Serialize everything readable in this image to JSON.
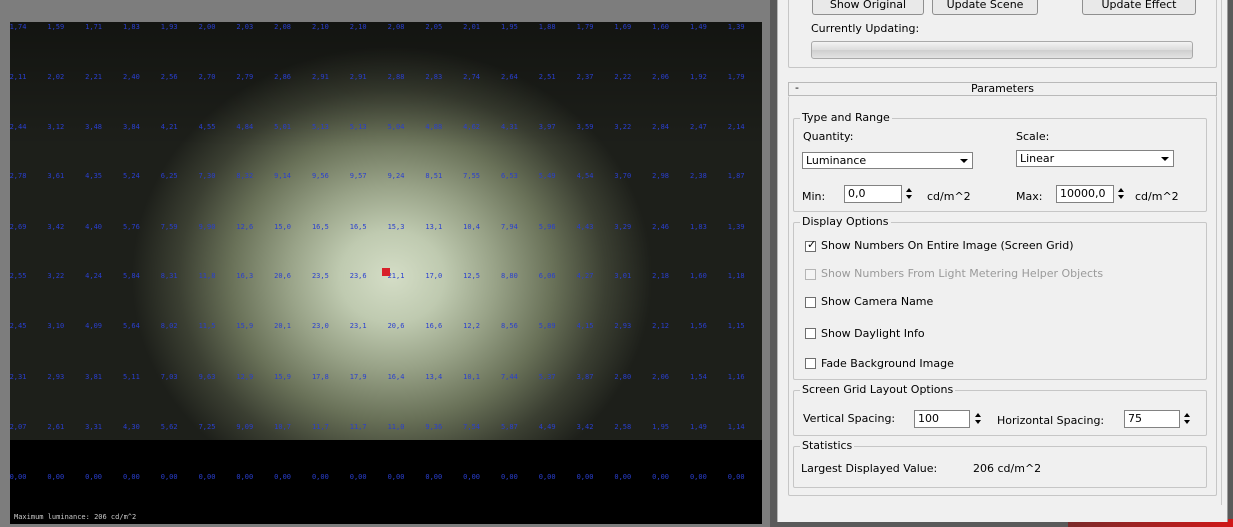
{
  "render": {
    "footer_text": "Maximum luminance: 206 cd/m^2",
    "grid_rows": [
      [
        "1,74",
        "1,59",
        "1,71",
        "1,83",
        "1,93",
        "2,00",
        "2,03",
        "2,08",
        "2,10",
        "2,10",
        "2,08",
        "2,05",
        "2,01",
        "1,95",
        "1,88",
        "1,79",
        "1,69",
        "1,60",
        "1,49",
        "1,39"
      ],
      [
        "2,11",
        "2,02",
        "2,21",
        "2,40",
        "2,56",
        "2,70",
        "2,79",
        "2,86",
        "2,91",
        "2,91",
        "2,88",
        "2,83",
        "2,74",
        "2,64",
        "2,51",
        "2,37",
        "2,22",
        "2,06",
        "1,92",
        "1,79"
      ],
      [
        "2,44",
        "3,12",
        "3,48",
        "3,84",
        "4,21",
        "4,55",
        "4,84",
        "5,01",
        "5,13",
        "5,13",
        "5,04",
        "4,88",
        "4,62",
        "4,31",
        "3,97",
        "3,59",
        "3,22",
        "2,84",
        "2,47",
        "2,14"
      ],
      [
        "2,78",
        "3,61",
        "4,35",
        "5,24",
        "6,25",
        "7,30",
        "8,32",
        "9,14",
        "9,56",
        "9,57",
        "9,24",
        "8,51",
        "7,55",
        "6,53",
        "5,49",
        "4,54",
        "3,70",
        "2,98",
        "2,38",
        "1,87"
      ],
      [
        "2,69",
        "3,42",
        "4,40",
        "5,76",
        "7,59",
        "9,90",
        "12,6",
        "15,0",
        "16,5",
        "16,5",
        "15,3",
        "13,1",
        "10,4",
        "7,94",
        "5,96",
        "4,43",
        "3,29",
        "2,46",
        "1,83",
        "1,39"
      ],
      [
        "2,55",
        "3,22",
        "4,24",
        "5,84",
        "8,31",
        "11,8",
        "16,3",
        "20,6",
        "23,5",
        "23,6",
        "21,1",
        "17,0",
        "12,5",
        "8,80",
        "6,06",
        "4,27",
        "3,01",
        "2,18",
        "1,60",
        "1,18"
      ],
      [
        "2,45",
        "3,10",
        "4,09",
        "5,64",
        "8,02",
        "11,5",
        "15,9",
        "20,1",
        "23,0",
        "23,1",
        "20,6",
        "16,6",
        "12,2",
        "8,56",
        "5,89",
        "4,15",
        "2,93",
        "2,12",
        "1,56",
        "1,15"
      ],
      [
        "2,31",
        "2,93",
        "3,81",
        "5,11",
        "7,03",
        "9,63",
        "12,9",
        "15,9",
        "17,8",
        "17,9",
        "16,4",
        "13,4",
        "10,1",
        "7,44",
        "5,37",
        "3,87",
        "2,80",
        "2,06",
        "1,54",
        "1,16"
      ],
      [
        "2,07",
        "2,61",
        "3,31",
        "4,30",
        "5,62",
        "7,25",
        "9,09",
        "10,7",
        "11,7",
        "11,7",
        "11,0",
        "9,36",
        "7,54",
        "5,87",
        "4,49",
        "3,42",
        "2,58",
        "1,95",
        "1,49",
        "1,14"
      ],
      [
        "0,00",
        "0,00",
        "0,00",
        "0,00",
        "0,00",
        "0,00",
        "0,00",
        "0,00",
        "0,00",
        "0,00",
        "0,00",
        "0,00",
        "0,00",
        "0,00",
        "0,00",
        "0,00",
        "0,00",
        "0,00",
        "0,00",
        "0,00"
      ]
    ]
  },
  "toolbar": {
    "show_original": "Show Original",
    "update_scene": "Update Scene",
    "update_effect": "Update Effect"
  },
  "status": {
    "currently_updating_label": "Currently Updating:",
    "progress": 0
  },
  "params": {
    "collapse_symbol": "-",
    "title": "Parameters",
    "type_range": {
      "legend": "Type and Range",
      "quantity_label": "Quantity:",
      "quantity_value": "Luminance",
      "scale_label": "Scale:",
      "scale_value": "Linear",
      "min_label": "Min:",
      "min_value": "0,0",
      "max_label": "Max:",
      "max_value": "10000,0",
      "unit": "cd/m^2"
    },
    "display": {
      "legend": "Display Options",
      "options": [
        {
          "label": "Show Numbers On Entire Image (Screen Grid)",
          "checked": true,
          "disabled": false
        },
        {
          "label": "Show Numbers From Light Metering Helper Objects",
          "checked": false,
          "disabled": true
        },
        {
          "label": "Show Camera Name",
          "checked": false,
          "disabled": false
        },
        {
          "label": "Show Daylight Info",
          "checked": false,
          "disabled": false
        },
        {
          "label": "Fade Background Image",
          "checked": false,
          "disabled": false
        }
      ]
    },
    "grid_layout": {
      "legend": "Screen Grid Layout Options",
      "vertical_label": "Vertical Spacing:",
      "vertical_value": "100",
      "horizontal_label": "Horizontal Spacing:",
      "horizontal_value": "75"
    },
    "statistics": {
      "legend": "Statistics",
      "largest_label": "Largest Displayed Value:",
      "largest_value": "206 cd/m^2"
    }
  },
  "colors": {
    "grid_number": "#2a3fd0",
    "marker": "#d8202a"
  }
}
